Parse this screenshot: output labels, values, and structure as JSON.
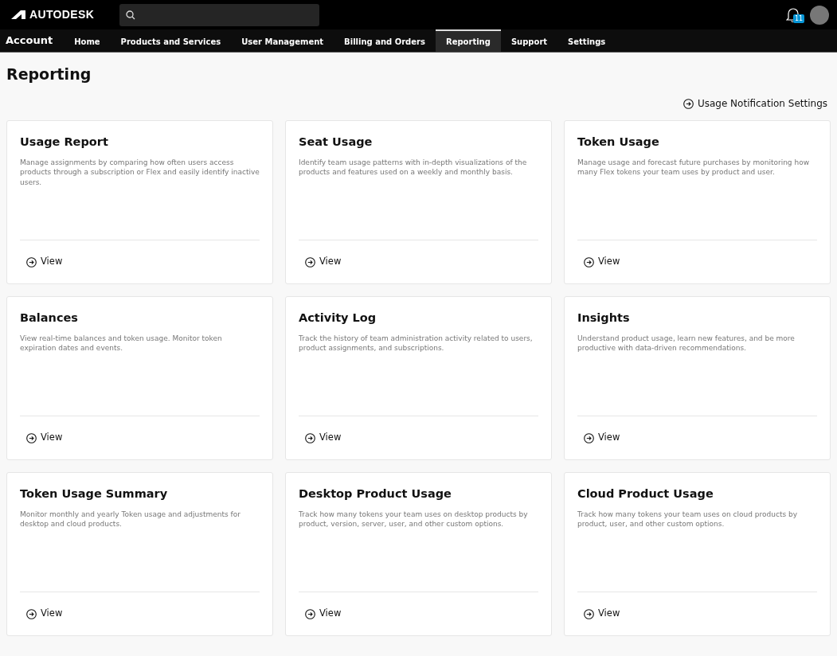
{
  "header": {
    "logo": "AUTODESK",
    "notifications": {
      "count": "11"
    }
  },
  "nav": {
    "title": "Account",
    "tabs": [
      {
        "label": "Home",
        "selected": false
      },
      {
        "label": "Products and Services",
        "selected": false
      },
      {
        "label": "User Management",
        "selected": false
      },
      {
        "label": "Billing and Orders",
        "selected": false
      },
      {
        "label": "Reporting",
        "selected": true
      },
      {
        "label": "Support",
        "selected": false
      },
      {
        "label": "Settings",
        "selected": false
      }
    ]
  },
  "page": {
    "title": "Reporting",
    "settings_link": "Usage Notification Settings"
  },
  "cards": [
    {
      "title": "Usage Report",
      "description": "Manage assignments by comparing how often users access products through a subscription or Flex and easily identify inactive users.",
      "action": "View"
    },
    {
      "title": "Seat Usage",
      "description": "Identify team usage patterns with in-depth visualizations of the products and features used on a weekly and monthly basis.",
      "action": "View"
    },
    {
      "title": "Token Usage",
      "description": "Manage usage and forecast future purchases by monitoring how many Flex tokens your team uses by product and user.",
      "action": "View"
    },
    {
      "title": "Balances",
      "description": "View real-time balances and token usage. Monitor token expiration dates and events.",
      "action": "View"
    },
    {
      "title": "Activity Log",
      "description": "Track the history of team administration activity related to users, product assignments, and subscriptions.",
      "action": "View"
    },
    {
      "title": "Insights",
      "description": "Understand product usage, learn new features, and be more productive with data-driven recommendations.",
      "action": "View"
    },
    {
      "title": "Token Usage Summary",
      "description": "Monitor monthly and yearly Token usage and adjustments for desktop and cloud products.",
      "action": "View"
    },
    {
      "title": "Desktop Product Usage",
      "description": "Track how many tokens your team uses on desktop products by product, version, server, user, and other custom options.",
      "action": "View"
    },
    {
      "title": "Cloud Product Usage",
      "description": "Track how many tokens your team uses on cloud products by product, user, and other custom options.",
      "action": "View"
    }
  ]
}
